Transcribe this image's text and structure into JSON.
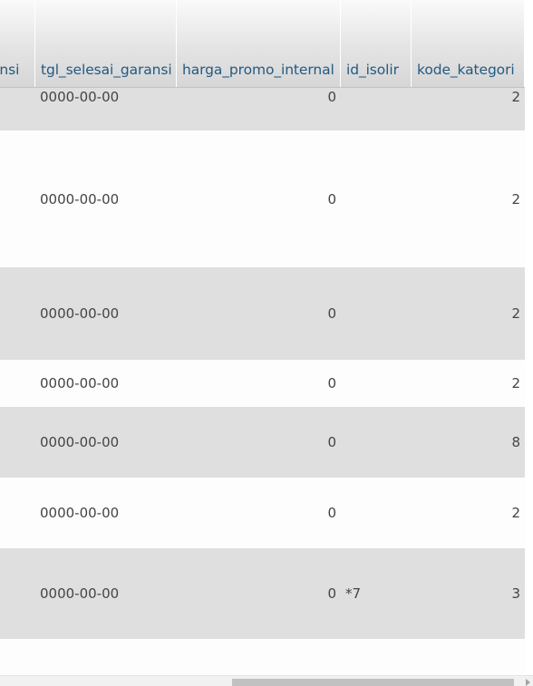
{
  "table": {
    "columns": [
      "ansi",
      "tgl_selesai_garansi",
      "harga_promo_internal",
      "id_isolir",
      "kode_kategori"
    ],
    "rows": [
      {
        "tgl_selesai_garansi": "0000-00-00",
        "harga_promo_internal": "0",
        "id_isolir": "",
        "kode_kategori": "2"
      },
      {
        "tgl_selesai_garansi": "0000-00-00",
        "harga_promo_internal": "0",
        "id_isolir": "",
        "kode_kategori": "2"
      },
      {
        "tgl_selesai_garansi": "0000-00-00",
        "harga_promo_internal": "0",
        "id_isolir": "",
        "kode_kategori": "2"
      },
      {
        "tgl_selesai_garansi": "0000-00-00",
        "harga_promo_internal": "0",
        "id_isolir": "",
        "kode_kategori": "2"
      },
      {
        "tgl_selesai_garansi": "0000-00-00",
        "harga_promo_internal": "0",
        "id_isolir": "",
        "kode_kategori": "8"
      },
      {
        "tgl_selesai_garansi": "0000-00-00",
        "harga_promo_internal": "0",
        "id_isolir": "",
        "kode_kategori": "2"
      },
      {
        "tgl_selesai_garansi": "0000-00-00",
        "harga_promo_internal": "0",
        "id_isolir": "*7",
        "kode_kategori": "3"
      },
      {
        "tgl_selesai_garansi": "",
        "harga_promo_internal": "",
        "id_isolir": "",
        "kode_kategori": ""
      }
    ]
  },
  "colors": {
    "header_text": "#235a81",
    "row_odd": "#dfdfdf",
    "row_even": "#fdfdfd",
    "cell_text": "#444444"
  }
}
